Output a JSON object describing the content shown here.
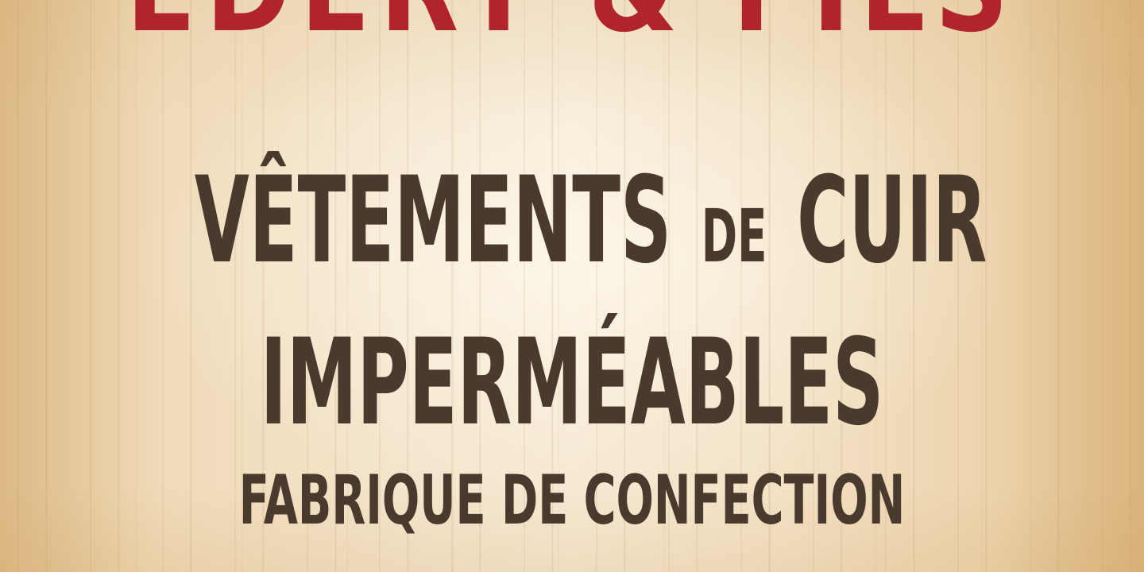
{
  "top_banner": {
    "text": "EDERT & FILS"
  },
  "headline": {
    "line1_main": "VÊTEMENTS",
    "line1_small": "DE",
    "line1_end": "CUIR",
    "line2": "IMPERMÉABLES",
    "line3": "FABRIQUE DE CONFECTION"
  },
  "colors": {
    "banner_red": "#b0242c",
    "ink_brown": "#4a3a2e",
    "wood_light": "#f4e5cc"
  }
}
